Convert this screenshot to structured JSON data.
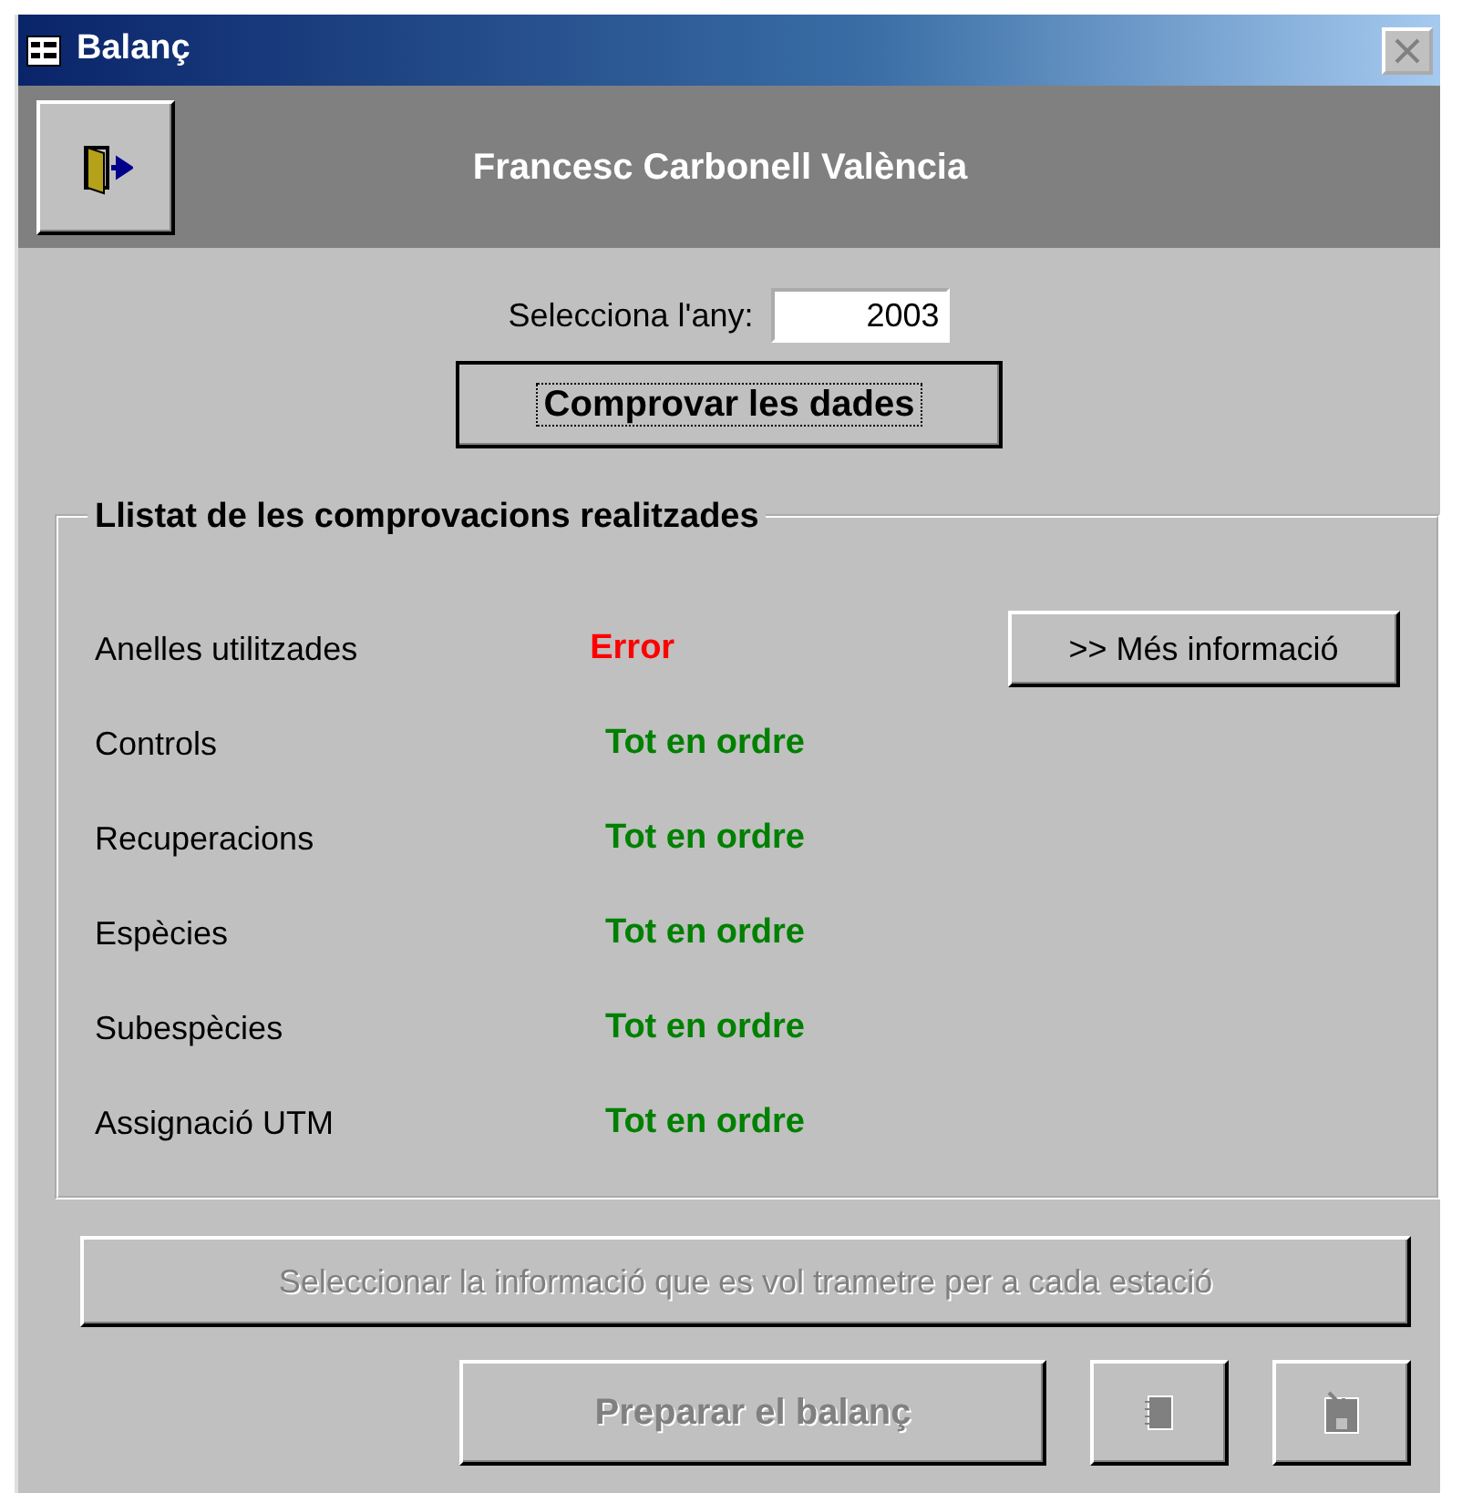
{
  "window": {
    "title": "Balanç"
  },
  "header": {
    "name": "Francesc Carbonell València"
  },
  "year": {
    "label": "Selecciona l'any:",
    "value": "2003"
  },
  "check_button": {
    "label": "Comprovar les dades"
  },
  "group": {
    "title": "Llistat de les comprovacions realitzades"
  },
  "checks": [
    {
      "label": "Anelles utilitzades",
      "status": "Error",
      "kind": "error",
      "button": ">> Més informació"
    },
    {
      "label": "Controls",
      "status": "Tot en ordre",
      "kind": "ok"
    },
    {
      "label": "Recuperacions",
      "status": "Tot en ordre",
      "kind": "ok"
    },
    {
      "label": "Espècies",
      "status": "Tot en ordre",
      "kind": "ok"
    },
    {
      "label": "Subespècies",
      "status": "Tot en ordre",
      "kind": "ok"
    },
    {
      "label": "Assignació UTM",
      "status": "Tot en ordre",
      "kind": "ok"
    }
  ],
  "select_button": {
    "label": "Seleccionar la informació que es vol trametre per a cada estació",
    "disabled": true
  },
  "prepare_button": {
    "label": "Preparar el balanç",
    "disabled": true
  },
  "icon_buttons": [
    {
      "kind": "book",
      "disabled": true
    },
    {
      "kind": "save",
      "disabled": true
    }
  ]
}
